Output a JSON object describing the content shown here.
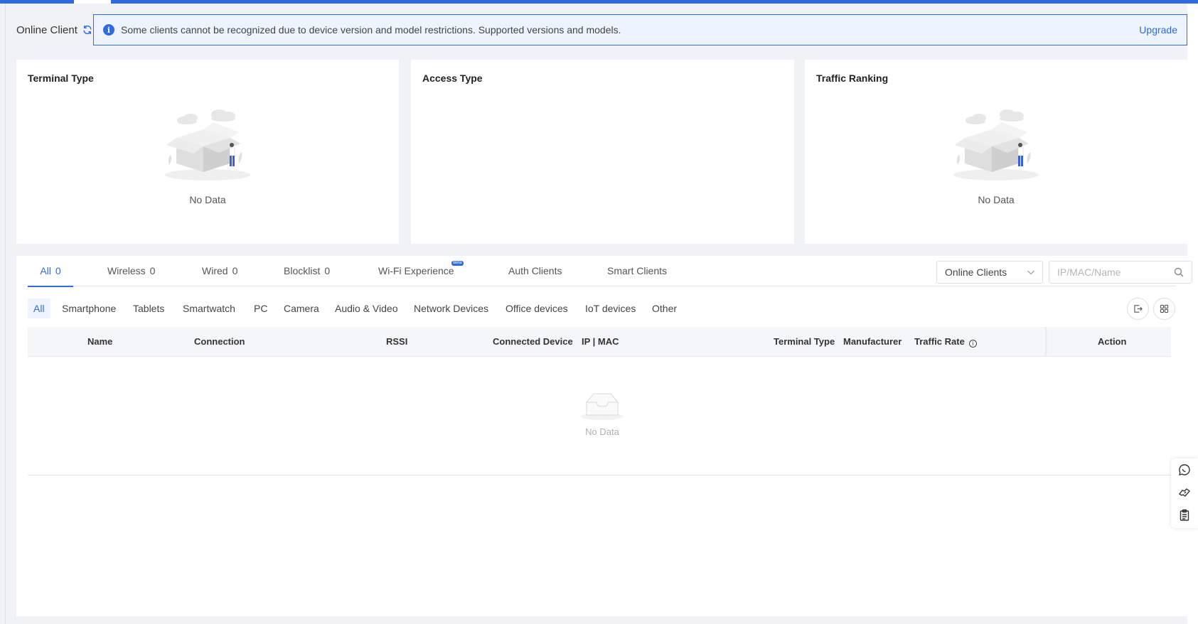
{
  "header": {
    "title": "Online Client",
    "notice": "Some clients cannot be recognized due to device version and model restrictions. Supported versions and models.",
    "upgrade": "Upgrade"
  },
  "cards": {
    "terminal_type": {
      "title": "Terminal Type",
      "empty": "No Data"
    },
    "access_type": {
      "title": "Access Type"
    },
    "traffic_ranking": {
      "title": "Traffic Ranking",
      "empty": "No Data"
    }
  },
  "tabs": [
    {
      "label": "All",
      "count": "0"
    },
    {
      "label": "Wireless",
      "count": "0"
    },
    {
      "label": "Wired",
      "count": "0"
    },
    {
      "label": "Blocklist",
      "count": "0"
    },
    {
      "label": "Wi-Fi Experience",
      "badge": "Beta"
    },
    {
      "label": "Auth Clients"
    },
    {
      "label": "Smart Clients"
    }
  ],
  "filter": {
    "selected": "Online Clients",
    "search_placeholder": "IP/MAC/Name"
  },
  "categories": [
    "All",
    "Smartphone",
    "Tablets",
    "Smartwatch",
    "PC",
    "Camera",
    "Audio & Video",
    "Network Devices",
    "Office devices",
    "IoT devices",
    "Other"
  ],
  "table": {
    "columns": [
      "Name",
      "Connection",
      "RSSI",
      "Connected Device",
      "IP | MAC",
      "Terminal Type",
      "Manufacturer",
      "Traffic Rate",
      "Action"
    ],
    "empty": "No Data"
  }
}
